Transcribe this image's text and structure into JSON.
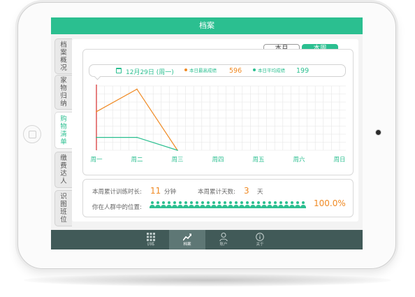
{
  "header": {
    "title": "档案"
  },
  "sidebar": {
    "tabs": [
      {
        "label": "档案概况",
        "active": false
      },
      {
        "label": "家物归纳",
        "active": false
      },
      {
        "label": "购物清单",
        "active": true
      },
      {
        "label": "缴费达人",
        "active": false
      },
      {
        "label": "识图班位",
        "active": false
      }
    ]
  },
  "segmented": {
    "month_label": "本月",
    "week_label": "本周",
    "selected": "本周"
  },
  "info": {
    "date": "12月29日 (周一)",
    "max_label": "本日最高成绩",
    "max_value": "596",
    "avg_label": "本日平均成绩",
    "avg_value": "199"
  },
  "chart_data": {
    "type": "line",
    "categories": [
      "周一",
      "周二",
      "周三",
      "周四",
      "周五",
      "周六",
      "周日"
    ],
    "ylim": [
      0,
      1
    ],
    "series": [
      {
        "color": "#f08a24",
        "values": [
          0.6,
          0.95,
          0.0
        ]
      },
      {
        "color": "#2bbf90",
        "values": [
          0.2,
          0.2,
          0.0
        ]
      }
    ],
    "today_marker_index": 0,
    "grid": true
  },
  "stats": {
    "training_label": "本周累计训练时长:",
    "training_value": "11",
    "training_unit": "分钟",
    "days_label": "本周累计天数:",
    "days_value": "3",
    "days_unit": "天",
    "rank_label": "你在人群中的位置:",
    "rank_value": "100.0%",
    "people_count": 28
  },
  "nav": {
    "items": [
      {
        "label": "训练",
        "icon": "grid-icon",
        "active": false
      },
      {
        "label": "档案",
        "icon": "chart-icon",
        "active": true
      },
      {
        "label": "账户",
        "icon": "user-icon",
        "active": false
      },
      {
        "label": "关于",
        "icon": "info-icon",
        "active": false
      }
    ]
  },
  "colors": {
    "accent": "#2bbf90",
    "orange": "#f08a24",
    "today_line": "#e06060",
    "nav_bg": "#415a58"
  }
}
